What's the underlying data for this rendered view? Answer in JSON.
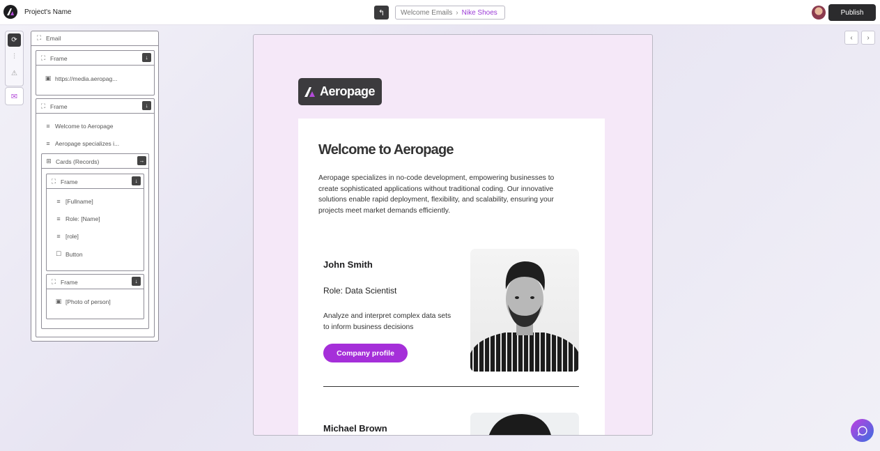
{
  "header": {
    "project_name": "Project's Name",
    "back_icon": "undo-icon",
    "breadcrumb": [
      "Welcome Emails",
      "Nike Shoes"
    ],
    "publish_label": "Publish"
  },
  "rail": {
    "items": [
      "refresh-icon",
      "sliders-icon",
      "warning-icon"
    ],
    "mail": "mail-icon"
  },
  "tree": {
    "root": "Email",
    "frame1": {
      "label": "Frame",
      "child": "https://media.aeropag..."
    },
    "frame2": {
      "label": "Frame",
      "children": [
        "Welcome to Aeropage",
        "Aeropage specializes i..."
      ],
      "cards": {
        "label": "Cards (Records)",
        "frame_a": {
          "label": "Frame",
          "children": [
            "[Fullname]",
            "Role: [Name]",
            "[role]",
            "Button"
          ]
        },
        "frame_b": {
          "label": "Frame",
          "child": "[Photo of person]"
        }
      }
    }
  },
  "email": {
    "brand": "Aeropage",
    "title": "Welcome to Aeropage",
    "intro": "Aeropage specializes in no-code development, empowering businesses to create sophisticated applications without traditional coding. Our innovative solutions enable rapid deployment, flexibility, and scalability, ensuring your projects meet market demands efficiently.",
    "person1": {
      "name": "John Smith",
      "role": "Role: Data Scientist",
      "desc": "Analyze and interpret complex data sets to inform business decisions",
      "cta": "Company profile"
    },
    "person2": {
      "name": "Michael Brown"
    }
  },
  "colors": {
    "accent": "#a52fd9",
    "dark": "#2b2b2d",
    "canvas_bg": "#f5e8f8"
  }
}
